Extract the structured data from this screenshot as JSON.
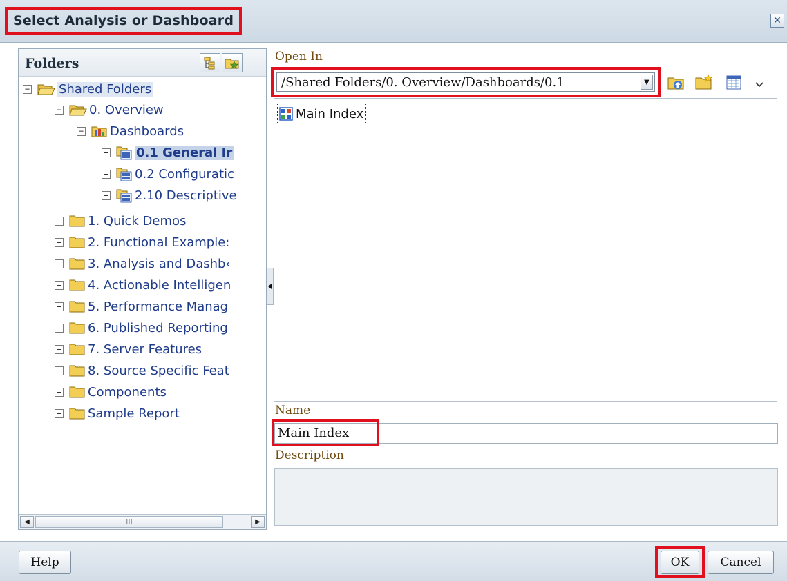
{
  "dialog": {
    "title": "Select Analysis or Dashboard",
    "close_icon": "close-icon"
  },
  "folders": {
    "title": "Folders",
    "header_buttons": [
      "folder-tree-icon",
      "favorites-folder-icon"
    ],
    "tree": [
      {
        "label": "Shared Folders",
        "toggle": "⊟",
        "icon": "open-folder-icon",
        "level": 0,
        "state": "shared"
      },
      {
        "label": "0. Overview",
        "toggle": "⊟",
        "icon": "open-folder-icon",
        "level": 1
      },
      {
        "label": "Dashboards",
        "toggle": "⊟",
        "icon": "dashboard-folder-icon",
        "level": 2
      },
      {
        "label": "0.1 General Ir",
        "toggle": "⊞",
        "icon": "dashboard-page-icon",
        "level": 3,
        "state": "selected"
      },
      {
        "label": "0.2 Configuratic",
        "toggle": "⊞",
        "icon": "dashboard-page-icon",
        "level": 3
      },
      {
        "label": "2.10 Descriptive",
        "toggle": "⊞",
        "icon": "dashboard-page-icon",
        "level": 3
      },
      {
        "label": "1. Quick Demos",
        "toggle": "⊞",
        "icon": "folder-icon",
        "level": 1
      },
      {
        "label": "2. Functional Example:",
        "toggle": "⊞",
        "icon": "folder-icon",
        "level": 1
      },
      {
        "label": "3. Analysis and Dashb‹",
        "toggle": "⊞",
        "icon": "folder-icon",
        "level": 1
      },
      {
        "label": "4. Actionable Intelligen",
        "toggle": "⊞",
        "icon": "folder-icon",
        "level": 1
      },
      {
        "label": "5. Performance Manag",
        "toggle": "⊞",
        "icon": "folder-icon",
        "level": 1
      },
      {
        "label": "6. Published Reporting",
        "toggle": "⊞",
        "icon": "folder-icon",
        "level": 1
      },
      {
        "label": "7. Server Features",
        "toggle": "⊞",
        "icon": "folder-icon",
        "level": 1
      },
      {
        "label": "8. Source Specific Feat",
        "toggle": "⊞",
        "icon": "folder-icon",
        "level": 1
      },
      {
        "label": "Components",
        "toggle": "⊞",
        "icon": "folder-icon",
        "level": 1
      },
      {
        "label": "Sample Report",
        "toggle": "⊞",
        "icon": "folder-icon",
        "level": 1
      }
    ],
    "scroll_thumb_text": "III"
  },
  "open_in": {
    "label": "Open In",
    "path": "/Shared Folders/0. Overview/Dashboards/0.1",
    "toolbar_icons": [
      "folder-up-icon",
      "new-folder-icon",
      "view-options-icon"
    ]
  },
  "files": [
    {
      "label": "Main Index",
      "icon": "dashboard-grid-icon"
    }
  ],
  "name": {
    "label": "Name",
    "value": "Main Index"
  },
  "description": {
    "label": "Description",
    "value": ""
  },
  "footer": {
    "help_label": "Help",
    "ok_label": "OK",
    "cancel_label": "Cancel"
  },
  "colors": {
    "highlight_red": "#e0101e",
    "tree_link_blue": "#1f3c8a",
    "field_label_brown": "#6f4a0c",
    "folder_yellow": "#f2cf54"
  }
}
